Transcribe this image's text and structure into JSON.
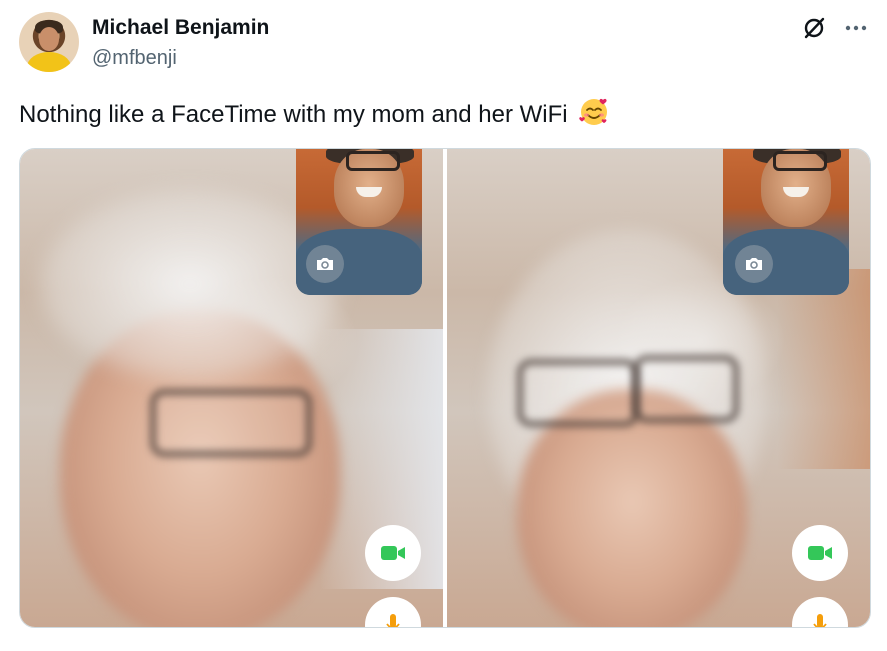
{
  "author": {
    "display_name": "Michael Benjamin",
    "handle": "@mfbenji"
  },
  "header_icons": [
    "grok-icon",
    "more-icon"
  ],
  "tweet": {
    "text": "Nothing like a FaceTime with my mom and her WiFi",
    "emoji": "smiling-face-with-hearts-emoji"
  },
  "media": {
    "images": [
      {
        "controls": [
          "camera-flip-icon",
          "video-camera-icon",
          "microphone-icon"
        ]
      },
      {
        "controls": [
          "camera-flip-icon",
          "video-camera-icon",
          "microphone-icon"
        ]
      }
    ]
  },
  "colors": {
    "text_primary": "#0f1419",
    "text_secondary": "#536471",
    "border": "#cfd9de",
    "facetime_green": "#34c759",
    "mic_orange": "#f59e0b"
  }
}
